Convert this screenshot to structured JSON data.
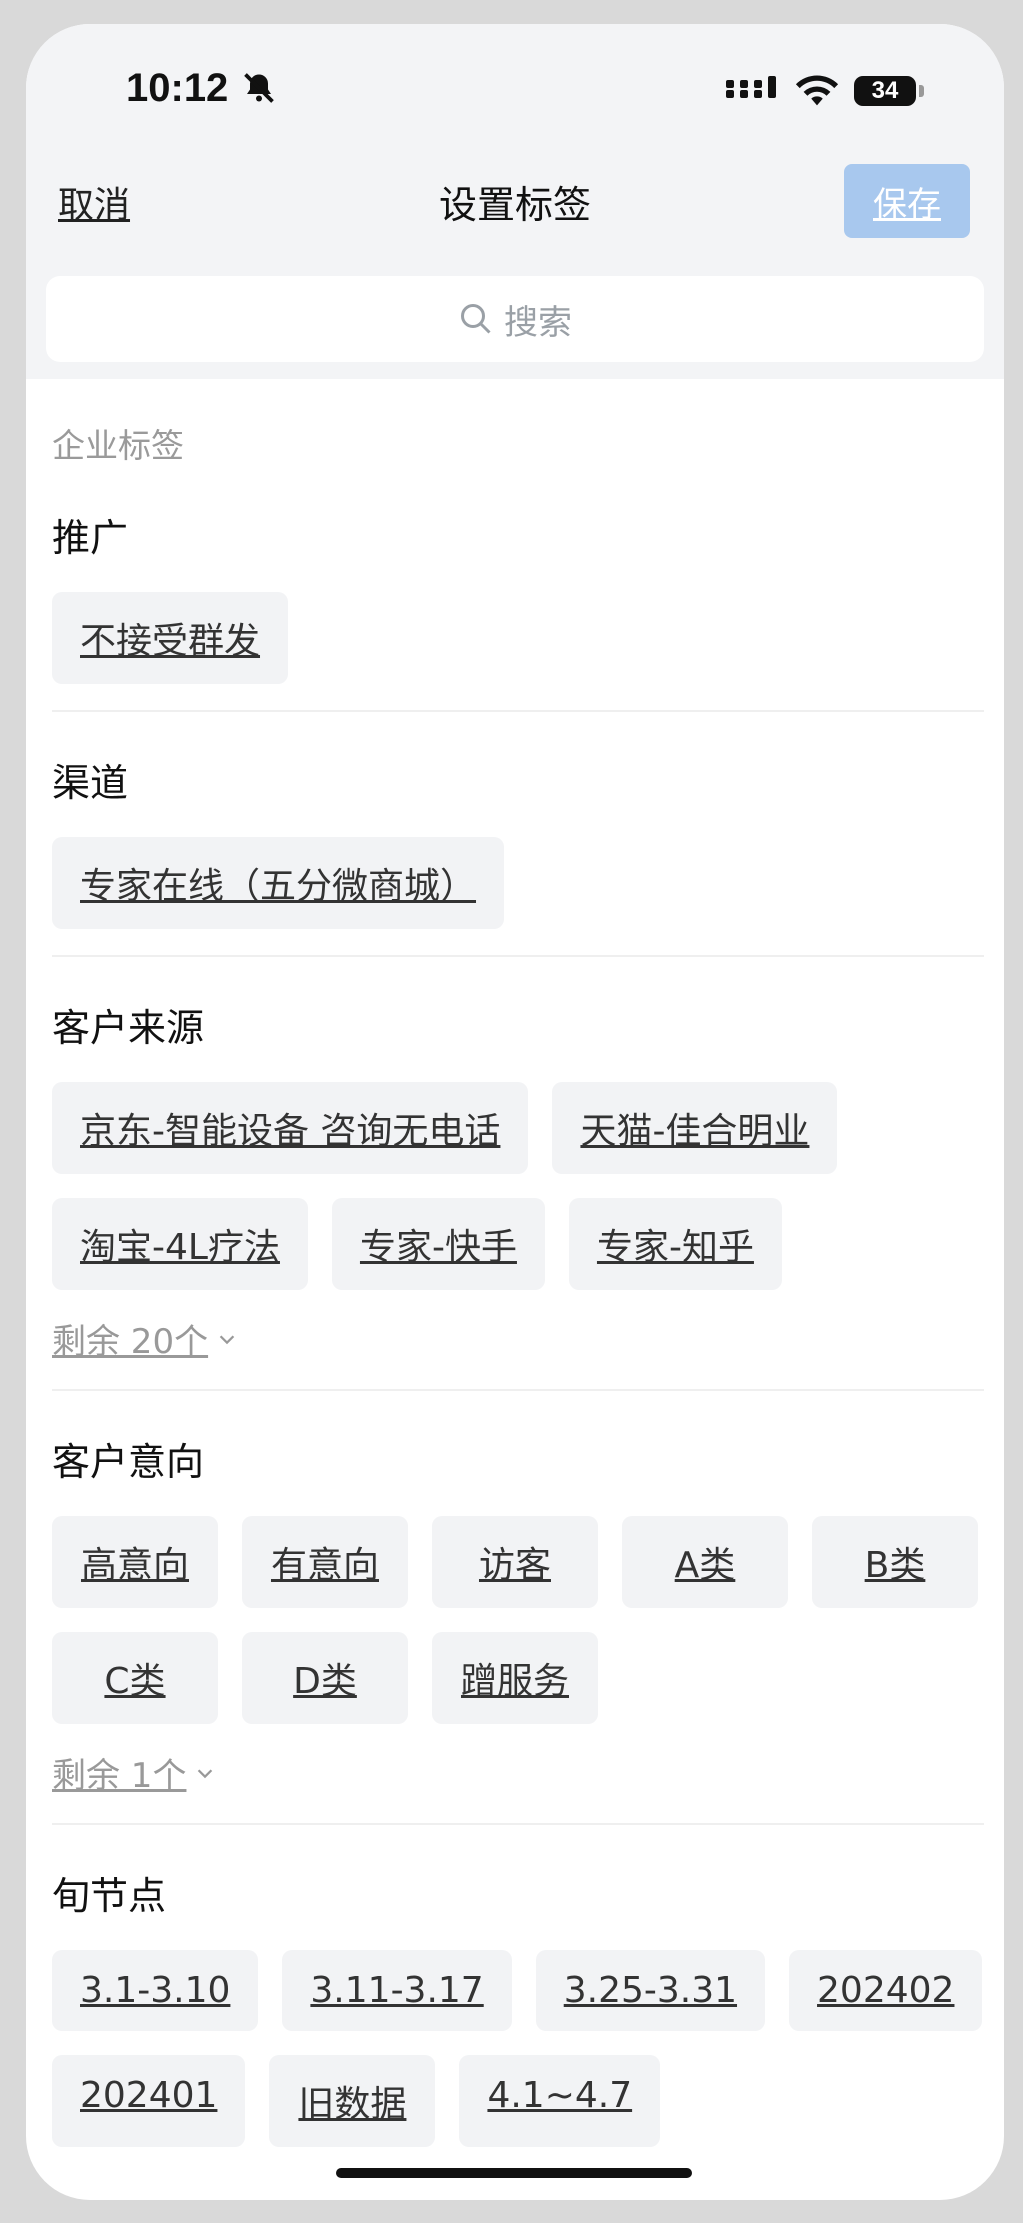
{
  "status": {
    "time": "10:12",
    "battery": "34"
  },
  "header": {
    "cancel": "取消",
    "title": "设置标签",
    "save": "保存"
  },
  "search": {
    "placeholder": "搜索"
  },
  "section_label": "企业标签",
  "groups": [
    {
      "title": "推广",
      "tags": [
        "不接受群发"
      ]
    },
    {
      "title": "渠道",
      "tags": [
        "专家在线（五分微商城）"
      ]
    },
    {
      "title": "客户来源",
      "tags": [
        "京东-智能设备 咨询无电话",
        "天猫-佳合明业",
        "淘宝-4L疗法",
        "专家-快手",
        "专家-知乎"
      ],
      "more": "剩余 20个"
    },
    {
      "title": "客户意向",
      "tags": [
        "高意向",
        "有意向",
        "访客",
        "A类",
        "B类",
        "C类",
        "D类",
        "蹭服务"
      ],
      "more": "剩余 1个"
    },
    {
      "title": "旬节点",
      "tags": [
        "3.1-3.10",
        "3.11-3.17",
        "3.25-3.31",
        "202402",
        "202401",
        "旧数据",
        "4.1~4.7"
      ]
    }
  ],
  "colors": {
    "save_bg": "#a8c8ee",
    "topbar_bg": "#f3f4f6",
    "tag_bg": "#f2f3f5"
  }
}
